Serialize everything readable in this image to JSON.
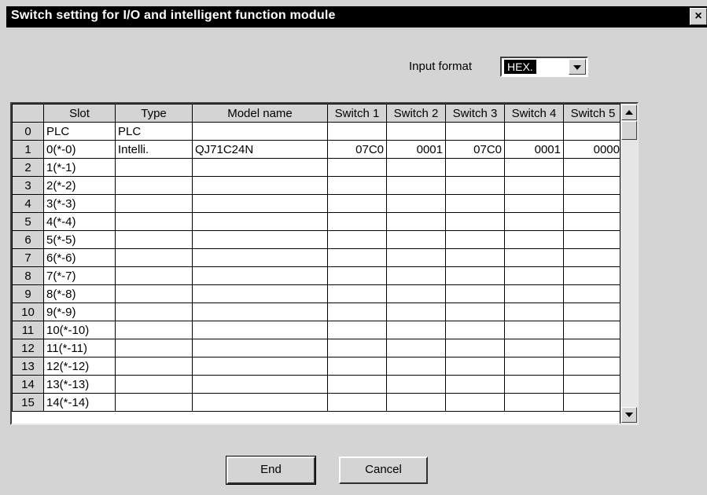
{
  "window": {
    "title": "Switch setting for I/O and intelligent function module",
    "close_glyph": "×"
  },
  "input_format": {
    "label": "Input format",
    "selected": "HEX."
  },
  "grid": {
    "columns": [
      "",
      "Slot",
      "Type",
      "Model name",
      "Switch 1",
      "Switch 2",
      "Switch 3",
      "Switch 4",
      "Switch 5"
    ],
    "rows": [
      [
        "0",
        "PLC",
        "PLC",
        "",
        "",
        "",
        "",
        "",
        ""
      ],
      [
        "1",
        "0(*-0)",
        "Intelli.",
        "QJ71C24N",
        "07C0",
        "0001",
        "07C0",
        "0001",
        "0000"
      ],
      [
        "2",
        "1(*-1)",
        "",
        "",
        "",
        "",
        "",
        "",
        ""
      ],
      [
        "3",
        "2(*-2)",
        "",
        "",
        "",
        "",
        "",
        "",
        ""
      ],
      [
        "4",
        "3(*-3)",
        "",
        "",
        "",
        "",
        "",
        "",
        ""
      ],
      [
        "5",
        "4(*-4)",
        "",
        "",
        "",
        "",
        "",
        "",
        ""
      ],
      [
        "6",
        "5(*-5)",
        "",
        "",
        "",
        "",
        "",
        "",
        ""
      ],
      [
        "7",
        "6(*-6)",
        "",
        "",
        "",
        "",
        "",
        "",
        ""
      ],
      [
        "8",
        "7(*-7)",
        "",
        "",
        "",
        "",
        "",
        "",
        ""
      ],
      [
        "9",
        "8(*-8)",
        "",
        "",
        "",
        "",
        "",
        "",
        ""
      ],
      [
        "10",
        "9(*-9)",
        "",
        "",
        "",
        "",
        "",
        "",
        ""
      ],
      [
        "11",
        "10(*-10)",
        "",
        "",
        "",
        "",
        "",
        "",
        ""
      ],
      [
        "12",
        "11(*-11)",
        "",
        "",
        "",
        "",
        "",
        "",
        ""
      ],
      [
        "13",
        "12(*-12)",
        "",
        "",
        "",
        "",
        "",
        "",
        ""
      ],
      [
        "14",
        "13(*-13)",
        "",
        "",
        "",
        "",
        "",
        "",
        ""
      ],
      [
        "15",
        "14(*-14)",
        "",
        "",
        "",
        "",
        "",
        "",
        ""
      ]
    ]
  },
  "buttons": {
    "end": "End",
    "cancel": "Cancel"
  },
  "colors": {
    "dialog_bg": "#d4d4d4",
    "titlebar_bg": "#000000",
    "title_text": "#ffffff",
    "grid_bg": "#ffffff"
  }
}
